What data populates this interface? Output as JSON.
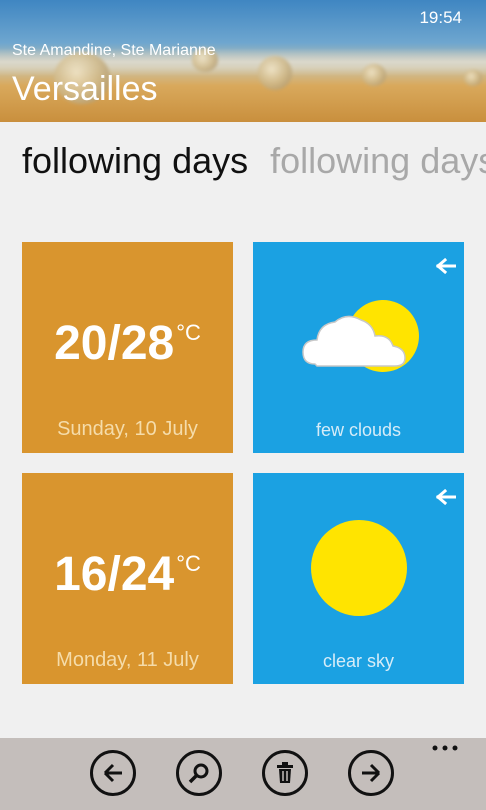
{
  "status_bar": {
    "time": "19:54"
  },
  "header": {
    "saints": "Ste Amandine, Ste Marianne",
    "city": "Versailles"
  },
  "pivot": {
    "active_label": "following days",
    "next_label": "following days"
  },
  "days": [
    {
      "temperature": "20/28",
      "unit": "°C",
      "date": "Sunday, 10 July",
      "condition": "few clouds",
      "condition_icon": "sun-behind-cloud-icon"
    },
    {
      "temperature": "16/24",
      "unit": "°C",
      "date": "Monday, 11 July",
      "condition": "clear sky",
      "condition_icon": "sun-icon"
    }
  ],
  "app_bar": {
    "buttons": [
      {
        "icon": "back-arrow-icon"
      },
      {
        "icon": "search-icon"
      },
      {
        "icon": "delete-icon"
      },
      {
        "icon": "forward-arrow-icon"
      }
    ],
    "more_icon": "ellipsis-icon"
  },
  "colors": {
    "temperature_tile": "#d9952e",
    "sky_tile": "#1ba1e2",
    "app_bar": "#c4bebb",
    "sun": "#ffe400"
  }
}
